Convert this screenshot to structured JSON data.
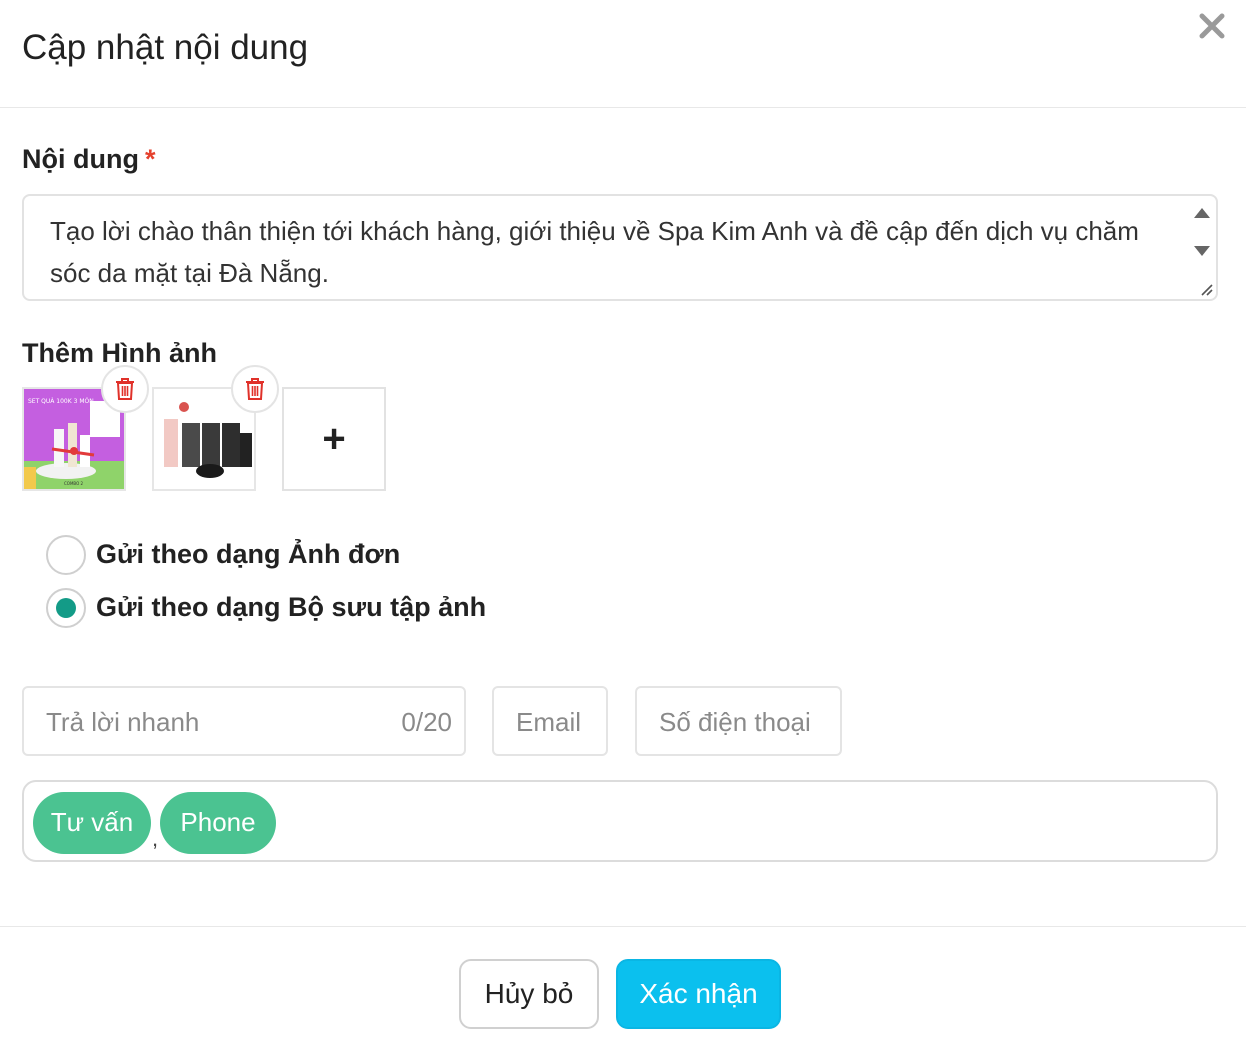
{
  "dialog": {
    "title": "Cập nhật nội dung",
    "close_icon": "close-icon"
  },
  "content_field": {
    "label": "Nội dung",
    "required_mark": "*",
    "value": "Tạo lời chào thân thiện tới khách hàng, giới thiệu về Spa Kim Anh và đề cập đến dịch vụ chăm sóc da mặt tại Đà Nẵng."
  },
  "images": {
    "label": "Thêm Hình ảnh",
    "items": [
      {
        "name": "product-image-1",
        "caption_top": "SET QUÀ 100K 3 MÓN",
        "caption_bottom": "COMBO 2",
        "delete_icon": "trash-icon"
      },
      {
        "name": "product-image-2",
        "delete_icon": "trash-icon"
      }
    ],
    "add_label": "+"
  },
  "send_mode": {
    "options": [
      {
        "label": "Gửi theo dạng Ảnh đơn",
        "selected": false
      },
      {
        "label": "Gửi theo dạng Bộ sưu tập ảnh",
        "selected": true
      }
    ]
  },
  "buttons_row": {
    "quick_reply_placeholder": "Trả lời nhanh",
    "quick_reply_counter": "0/20",
    "email_placeholder": "Email",
    "phone_placeholder": "Số điện thoại"
  },
  "tags": {
    "items": [
      "Tư vấn",
      "Phone"
    ],
    "separator": ","
  },
  "footer": {
    "cancel_label": "Hủy bỏ",
    "confirm_label": "Xác nhận"
  },
  "colors": {
    "accent_teal": "#139b87",
    "tag_green": "#4bc391",
    "confirm_blue": "#0bc0ee",
    "required_red": "#e5412d",
    "delete_red": "#e0312a"
  }
}
